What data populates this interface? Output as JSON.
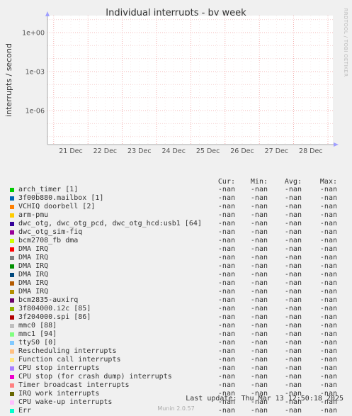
{
  "chart_data": {
    "type": "line",
    "title": "Individual interrupts - by week",
    "ylabel": "interrupts / second",
    "y_scale": "log",
    "y_ticks": [
      "1e+00",
      "1e-03",
      "1e-06"
    ],
    "x_ticks": [
      "21 Dec",
      "22 Dec",
      "23 Dec",
      "24 Dec",
      "25 Dec",
      "26 Dec",
      "27 Dec",
      "28 Dec"
    ],
    "grid": true,
    "series": [],
    "side_label": "RRDTOOL / TOBI OETIKER"
  },
  "table_headers": [
    "Cur:",
    "Min:",
    "Avg:",
    "Max:"
  ],
  "legend": [
    {
      "name": "arch_timer [1]",
      "color": "#00cc00",
      "cur": "-nan",
      "min": "-nan",
      "avg": "-nan",
      "max": "-nan"
    },
    {
      "name": "3f00b880.mailbox [1]",
      "color": "#0066b3",
      "cur": "-nan",
      "min": "-nan",
      "avg": "-nan",
      "max": "-nan"
    },
    {
      "name": "VCHIQ doorbell [2]",
      "color": "#ff8000",
      "cur": "-nan",
      "min": "-nan",
      "avg": "-nan",
      "max": "-nan"
    },
    {
      "name": "arm-pmu",
      "color": "#ffcc00",
      "cur": "-nan",
      "min": "-nan",
      "avg": "-nan",
      "max": "-nan"
    },
    {
      "name": "dwc_otg, dwc_otg_pcd, dwc_otg_hcd:usb1 [64]",
      "color": "#330099",
      "cur": "-nan",
      "min": "-nan",
      "avg": "-nan",
      "max": "-nan"
    },
    {
      "name": "dwc_otg_sim-fiq",
      "color": "#990099",
      "cur": "-nan",
      "min": "-nan",
      "avg": "-nan",
      "max": "-nan"
    },
    {
      "name": "bcm2708_fb dma",
      "color": "#ccff00",
      "cur": "-nan",
      "min": "-nan",
      "avg": "-nan",
      "max": "-nan"
    },
    {
      "name": "DMA IRQ",
      "color": "#ff0000",
      "cur": "-nan",
      "min": "-nan",
      "avg": "-nan",
      "max": "-nan"
    },
    {
      "name": "DMA IRQ",
      "color": "#808080",
      "cur": "-nan",
      "min": "-nan",
      "avg": "-nan",
      "max": "-nan"
    },
    {
      "name": "DMA IRQ",
      "color": "#008f00",
      "cur": "-nan",
      "min": "-nan",
      "avg": "-nan",
      "max": "-nan"
    },
    {
      "name": "DMA IRQ",
      "color": "#00487d",
      "cur": "-nan",
      "min": "-nan",
      "avg": "-nan",
      "max": "-nan"
    },
    {
      "name": "DMA IRQ",
      "color": "#b35a00",
      "cur": "-nan",
      "min": "-nan",
      "avg": "-nan",
      "max": "-nan"
    },
    {
      "name": "DMA IRQ",
      "color": "#b38f00",
      "cur": "-nan",
      "min": "-nan",
      "avg": "-nan",
      "max": "-nan"
    },
    {
      "name": "bcm2835-auxirq",
      "color": "#6b006b",
      "cur": "-nan",
      "min": "-nan",
      "avg": "-nan",
      "max": "-nan"
    },
    {
      "name": "3f804000.i2c [85]",
      "color": "#8fb300",
      "cur": "-nan",
      "min": "-nan",
      "avg": "-nan",
      "max": "-nan"
    },
    {
      "name": "3f204000.spi [86]",
      "color": "#b30000",
      "cur": "-nan",
      "min": "-nan",
      "avg": "-nan",
      "max": "-nan"
    },
    {
      "name": "mmc0 [88]",
      "color": "#bebebe",
      "cur": "-nan",
      "min": "-nan",
      "avg": "-nan",
      "max": "-nan"
    },
    {
      "name": "mmc1 [94]",
      "color": "#80ff80",
      "cur": "-nan",
      "min": "-nan",
      "avg": "-nan",
      "max": "-nan"
    },
    {
      "name": "ttyS0 [0]",
      "color": "#80c9ff",
      "cur": "-nan",
      "min": "-nan",
      "avg": "-nan",
      "max": "-nan"
    },
    {
      "name": "Rescheduling interrupts",
      "color": "#ffc080",
      "cur": "-nan",
      "min": "-nan",
      "avg": "-nan",
      "max": "-nan"
    },
    {
      "name": "Function call interrupts",
      "color": "#ffe680",
      "cur": "-nan",
      "min": "-nan",
      "avg": "-nan",
      "max": "-nan"
    },
    {
      "name": "CPU stop interrupts",
      "color": "#aa80ff",
      "cur": "-nan",
      "min": "-nan",
      "avg": "-nan",
      "max": "-nan"
    },
    {
      "name": "CPU stop (for crash dump) interrupts",
      "color": "#ee00cc",
      "cur": "-nan",
      "min": "-nan",
      "avg": "-nan",
      "max": "-nan"
    },
    {
      "name": "Timer broadcast interrupts",
      "color": "#ff8080",
      "cur": "-nan",
      "min": "-nan",
      "avg": "-nan",
      "max": "-nan"
    },
    {
      "name": "IRQ work interrupts",
      "color": "#666600",
      "cur": "-nan",
      "min": "-nan",
      "avg": "-nan",
      "max": "-nan"
    },
    {
      "name": "CPU wake-up interrupts",
      "color": "#ffbfff",
      "cur": "-nan",
      "min": "-nan",
      "avg": "-nan",
      "max": "-nan"
    },
    {
      "name": "Err",
      "color": "#00ffcc",
      "cur": "-nan",
      "min": "-nan",
      "avg": "-nan",
      "max": "-nan"
    }
  ],
  "last_update": "Last update: Thu Mar 13 12:50:18 2025",
  "footer": "Munin 2.0.57"
}
